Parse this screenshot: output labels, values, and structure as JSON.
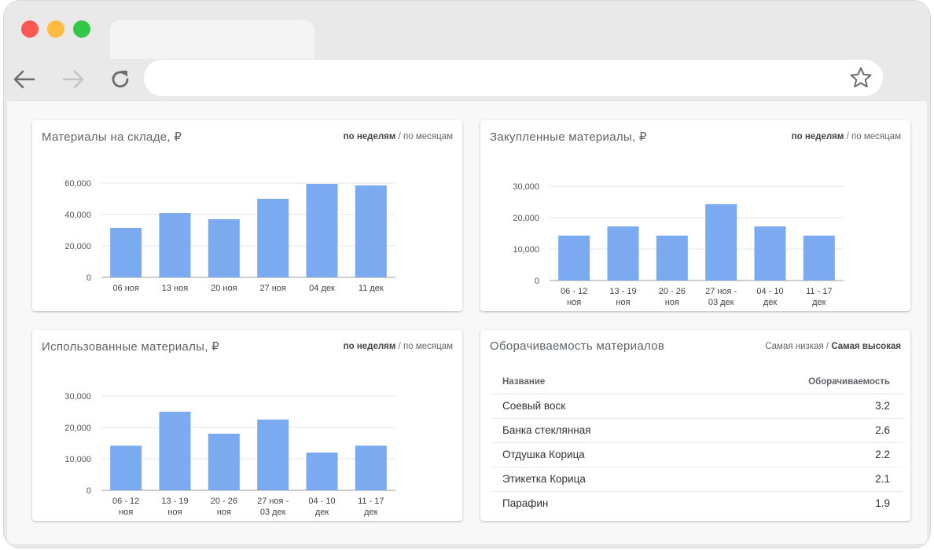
{
  "charts": [
    {
      "title": "Материалы на складе, ₽",
      "toggle": {
        "active": "по неделям",
        "sep": "/",
        "inactive": "по месяцам"
      },
      "chart_data": {
        "type": "bar",
        "title": "Материалы на складе, ₽",
        "categories": [
          "06 ноя",
          "13 ноя",
          "20 ноя",
          "27 ноя",
          "04 дек",
          "11 дек"
        ],
        "values": [
          31500,
          41000,
          37000,
          50000,
          59500,
          58500
        ],
        "ylim": [
          0,
          60000
        ],
        "yticks": [
          0,
          20000,
          40000,
          60000
        ],
        "ytick_labels": [
          "0",
          "20,000",
          "40,000",
          "60,000"
        ],
        "color": "#7baaf0",
        "grid": true
      }
    },
    {
      "title": "Закупленные материалы, ₽",
      "toggle": {
        "active": "по неделям",
        "sep": "/",
        "inactive": "по месяцам"
      },
      "chart_data": {
        "type": "bar",
        "title": "Закупленные материалы, ₽",
        "categories": [
          [
            "06 - 12",
            "ноя"
          ],
          [
            "13 - 19",
            "ноя"
          ],
          [
            "20 - 26",
            "ноя"
          ],
          [
            "27 ноя -",
            "03 дек"
          ],
          [
            "04 - 10",
            "дек"
          ],
          [
            "11 - 17",
            "дек"
          ]
        ],
        "values": [
          14300,
          17200,
          14300,
          24300,
          17200,
          14300
        ],
        "ylim": [
          0,
          30000
        ],
        "yticks": [
          0,
          10000,
          20000,
          30000
        ],
        "ytick_labels": [
          "0",
          "10,000",
          "20,000",
          "30,000"
        ],
        "color": "#7baaf0",
        "grid": true
      }
    },
    {
      "title": "Использованные материалы, ₽",
      "toggle": {
        "active": "по неделям",
        "sep": "/",
        "inactive": "по месяцам"
      },
      "chart_data": {
        "type": "bar",
        "title": "Использованные материалы, ₽",
        "categories": [
          [
            "06 - 12",
            "ноя"
          ],
          [
            "13 - 19",
            "ноя"
          ],
          [
            "20 - 26",
            "ноя"
          ],
          [
            "27 ноя -",
            "03 дек"
          ],
          [
            "04 - 10",
            "дек"
          ],
          [
            "11 - 17",
            "дек"
          ]
        ],
        "values": [
          14200,
          25000,
          18000,
          22500,
          12000,
          14200
        ],
        "ylim": [
          0,
          30000
        ],
        "yticks": [
          0,
          10000,
          20000,
          30000
        ],
        "ytick_labels": [
          "0",
          "10,000",
          "20,000",
          "30,000"
        ],
        "color": "#7baaf0",
        "grid": true
      }
    }
  ],
  "turnover": {
    "title": "Оборачиваемость материалов",
    "toggle": {
      "inactive": "Самая низкая",
      "sep": "/",
      "active": "Самая высокая"
    },
    "columns": {
      "name": "Название",
      "value": "Оборачиваемость"
    },
    "rows": [
      {
        "name": "Соевый воск",
        "value": "3.2"
      },
      {
        "name": "Банка стеклянная",
        "value": "2.6"
      },
      {
        "name": "Отдушка Корица",
        "value": "2.2"
      },
      {
        "name": "Этикетка Корица",
        "value": "2.1"
      },
      {
        "name": "Парафин",
        "value": "1.9"
      }
    ]
  }
}
